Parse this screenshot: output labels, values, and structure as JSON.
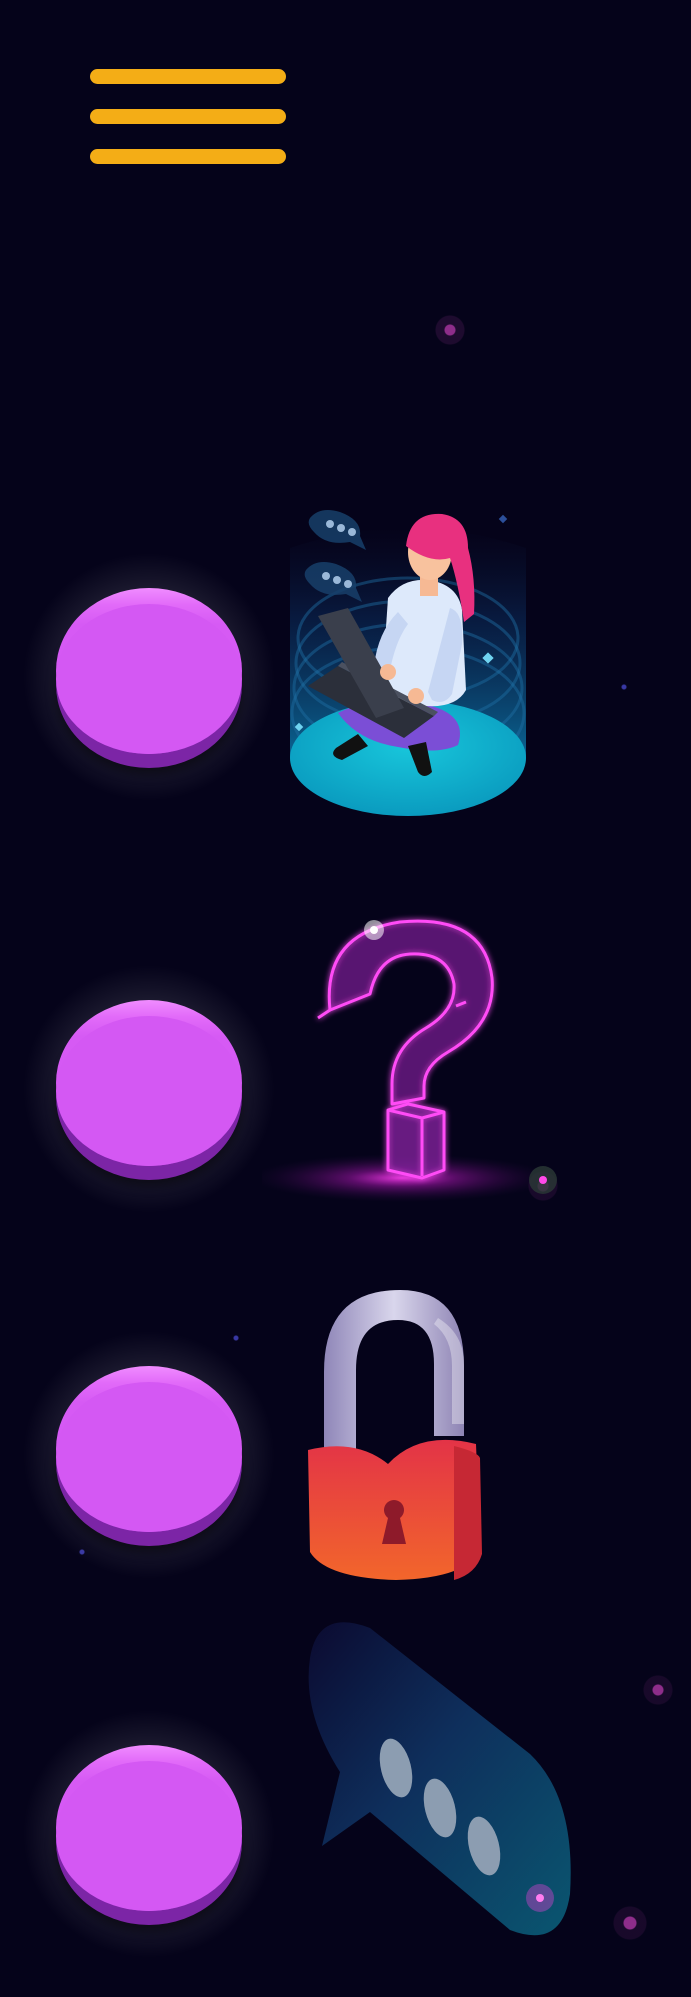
{
  "menu": {
    "icon": "hamburger-menu-icon",
    "color": "#f4ad16"
  },
  "options": [
    {
      "button_color": "#d458f3",
      "icon": "woman-with-laptop-illustration"
    },
    {
      "button_color": "#d458f3",
      "icon": "neon-question-mark-illustration"
    },
    {
      "button_color": "#d458f3",
      "icon": "open-padlock-illustration"
    },
    {
      "button_color": "#d458f3",
      "icon": "chat-bubble-illustration"
    }
  ],
  "background_color": "#05031a"
}
